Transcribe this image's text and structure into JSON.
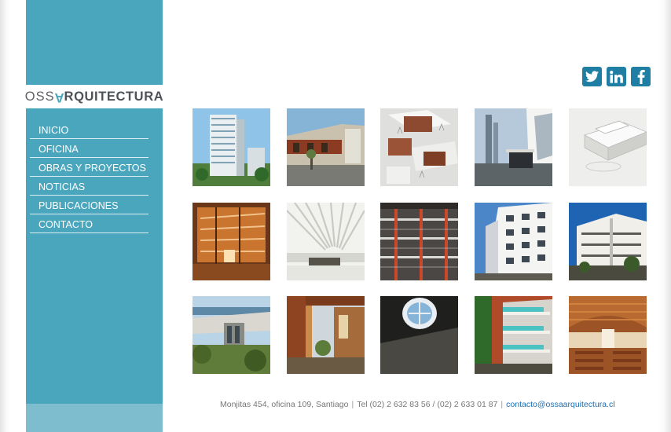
{
  "logo": {
    "part1": "OSS",
    "part_a": "A",
    "part2": "RQUITECTURA"
  },
  "nav": {
    "items": [
      {
        "label": "INICIO"
      },
      {
        "label": "OFICINA"
      },
      {
        "label": "OBRAS Y PROYECTOS"
      },
      {
        "label": "NOTICIAS"
      },
      {
        "label": "PUBLICACIONES"
      },
      {
        "label": "CONTACTO"
      }
    ]
  },
  "social": [
    {
      "name": "twitter-icon",
      "glyph": "t"
    },
    {
      "name": "linkedin-icon",
      "glyph": "in"
    },
    {
      "name": "facebook-icon",
      "glyph": "f"
    }
  ],
  "colors": {
    "sidebar": "#4aa6bd",
    "sidebar_bottom": "#7ebdcd",
    "social": "#1f7ea4",
    "link": "#1b6fb5"
  },
  "footer": {
    "address": "Monjitas 454, oficina 109, Santiago",
    "phone": "Tel (02) 2 632 83 56 / (02) 2 633 01 87",
    "email": "contacto@ossaarquitectura.cl"
  }
}
